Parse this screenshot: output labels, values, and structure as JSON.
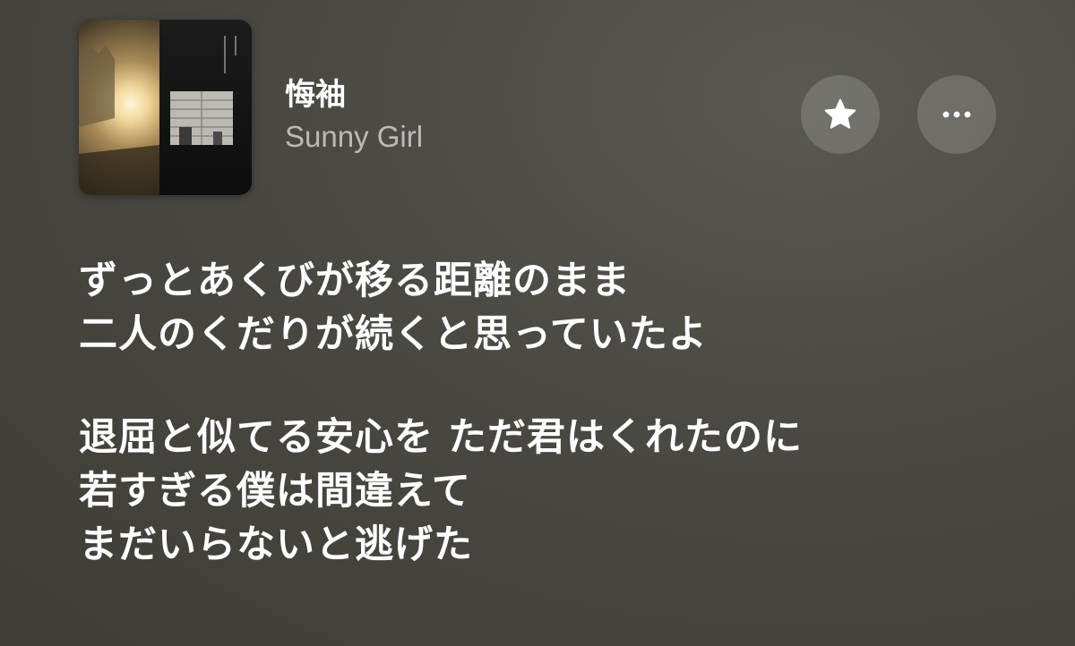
{
  "now_playing": {
    "title": "悔袖",
    "artist": "Sunny Girl",
    "artwork_icon": "album-artwork"
  },
  "actions": {
    "favorite_icon": "star-icon",
    "more_icon": "ellipsis-icon"
  },
  "lyrics": {
    "verse1": {
      "line1": "ずっとあくびが移る距離のまま",
      "line2": "二人のくだりが続くと思っていたよ"
    },
    "verse2": {
      "line1": "退屈と似てる安心を ただ君はくれたのに",
      "line2": "若すぎる僕は間違えて",
      "line3": "まだいらないと逃げた"
    }
  },
  "colors": {
    "background": "#4a4842",
    "text_primary": "#ffffff",
    "text_secondary": "#a8a6a0",
    "button_bg": "#64625c"
  }
}
